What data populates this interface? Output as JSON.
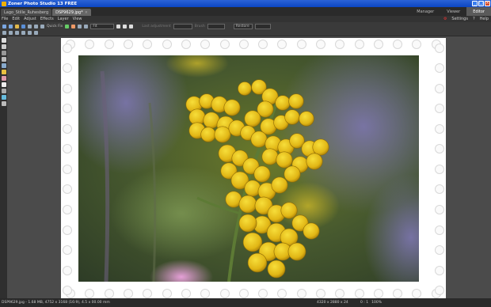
{
  "window": {
    "title": "Zoner Photo Studio 13 FREE"
  },
  "tabs": [
    {
      "label": "Lago_Stille_Ruhesberg"
    },
    {
      "label": "DSP9629.jpg*"
    }
  ],
  "modes": [
    "Manager",
    "Viewer",
    "Editor"
  ],
  "menu": [
    "File",
    "Edit",
    "Adjust",
    "Effects",
    "Layer",
    "View"
  ],
  "menu_right": [
    "Settings",
    "Help"
  ],
  "toolbar": {
    "quick_fix": "Quick Fix",
    "zoom_value": "Fit",
    "field1": "Last adjustment",
    "field2": "Brush",
    "field3": "Restore"
  },
  "status": {
    "file_info": "DSP9629.jpg - 1.68 MB, 4752 x 3168 (16:9), 4.5 x 00.00 mm",
    "coords": "4320 x 2880 x 24",
    "zoom": "0 : 1",
    "extra": "100%"
  },
  "colors": {
    "title_bar": "#0c46c2",
    "frame": "#ffffff",
    "flower": "#e8c21a",
    "bg_dark": "#3c3c3c"
  },
  "icons": [
    "app-icon",
    "minimize-icon",
    "maximize-icon",
    "close-icon",
    "settings-icon",
    "help-icon"
  ]
}
